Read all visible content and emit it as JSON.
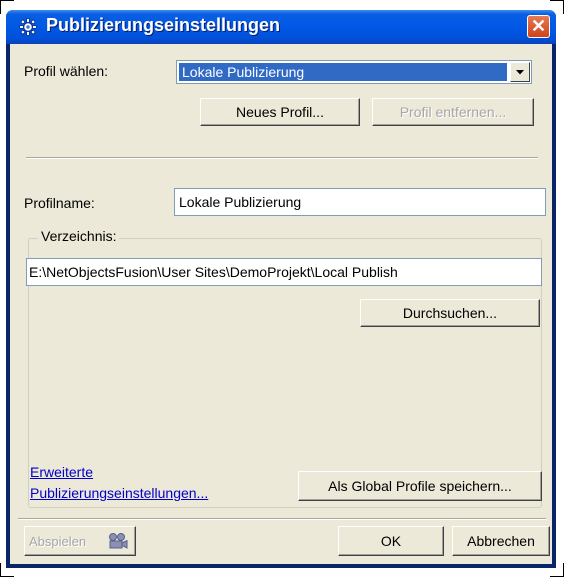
{
  "window": {
    "title": "Publizierungseinstellungen",
    "title_icon": "gear-icon",
    "close_icon": "close-icon",
    "close_glyph": "✕"
  },
  "profile_select": {
    "label": "Profil wählen:",
    "value": "Lokale Publizierung"
  },
  "buttons": {
    "new_profile": "Neues Profil...",
    "remove_profile": "Profil entfernen...",
    "browse": "Durchsuchen...",
    "save_global": "Als Global Profile speichern...",
    "play": "Abspielen",
    "ok": "OK",
    "cancel": "Abbrechen"
  },
  "profile_name": {
    "label": "Profilname:",
    "value": "Lokale Publizierung"
  },
  "directory": {
    "group_label": "Verzeichnis:",
    "path": "E:\\NetObjectsFusion\\User Sites\\DemoProjekt\\Local Publish"
  },
  "advanced_link": {
    "line1": "Erweiterte",
    "line2": "Publizierungseinstellungen..."
  },
  "colors": {
    "titlebar": "#0058e6",
    "dialog_bg": "#ece9d8",
    "selection": "#316ac5",
    "close_button": "#d1431a",
    "link": "#0000cc"
  }
}
